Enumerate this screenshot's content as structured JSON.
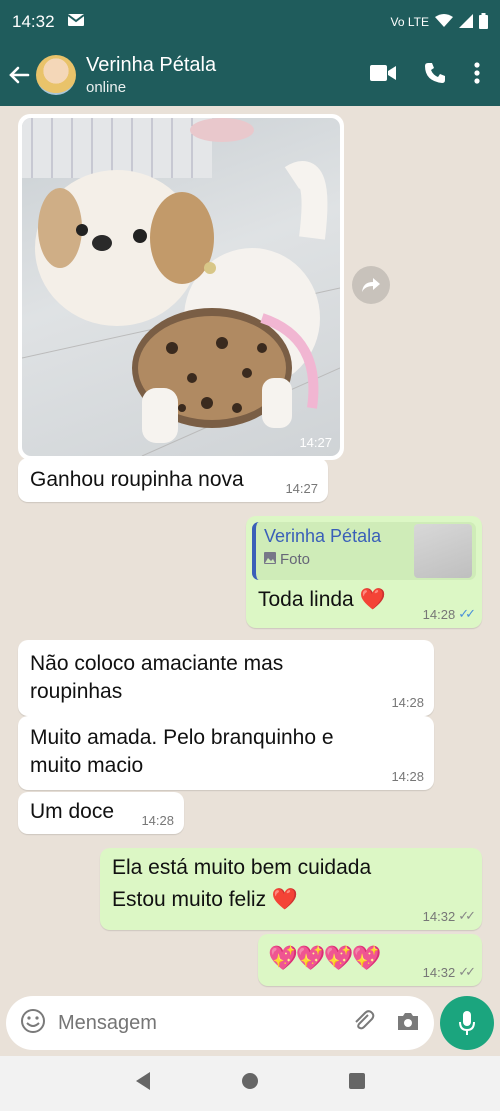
{
  "status_bar": {
    "time": "14:32",
    "network": "Vo LTE"
  },
  "header": {
    "contact_name": "Verinha Pétala",
    "contact_status": "online"
  },
  "messages": [
    {
      "time": "14:27"
    },
    {
      "text": "Ganhou roupinha nova",
      "time": "14:27"
    },
    {
      "reply_name": "Verinha Pétala",
      "reply_type": "Foto",
      "text": "Toda linda ❤️",
      "time": "14:28"
    },
    {
      "text": "Não coloco amaciante mas roupinhas",
      "time": "14:28"
    },
    {
      "text": "Muito amada. Pelo branquinho e muito macio",
      "time": "14:28"
    },
    {
      "text": "Um doce",
      "time": "14:28"
    },
    {
      "text1": "Ela está muito bem cuidada",
      "text2": "Estou muito feliz ❤️",
      "time": "14:32"
    },
    {
      "text": "💖💖💖💖",
      "time": "14:32"
    }
  ],
  "composer": {
    "placeholder": "Mensagem"
  },
  "colors": {
    "header": "#1f5c5c",
    "incoming": "#ffffff",
    "outgoing": "#dcf7c5",
    "mic": "#1ba57e"
  }
}
